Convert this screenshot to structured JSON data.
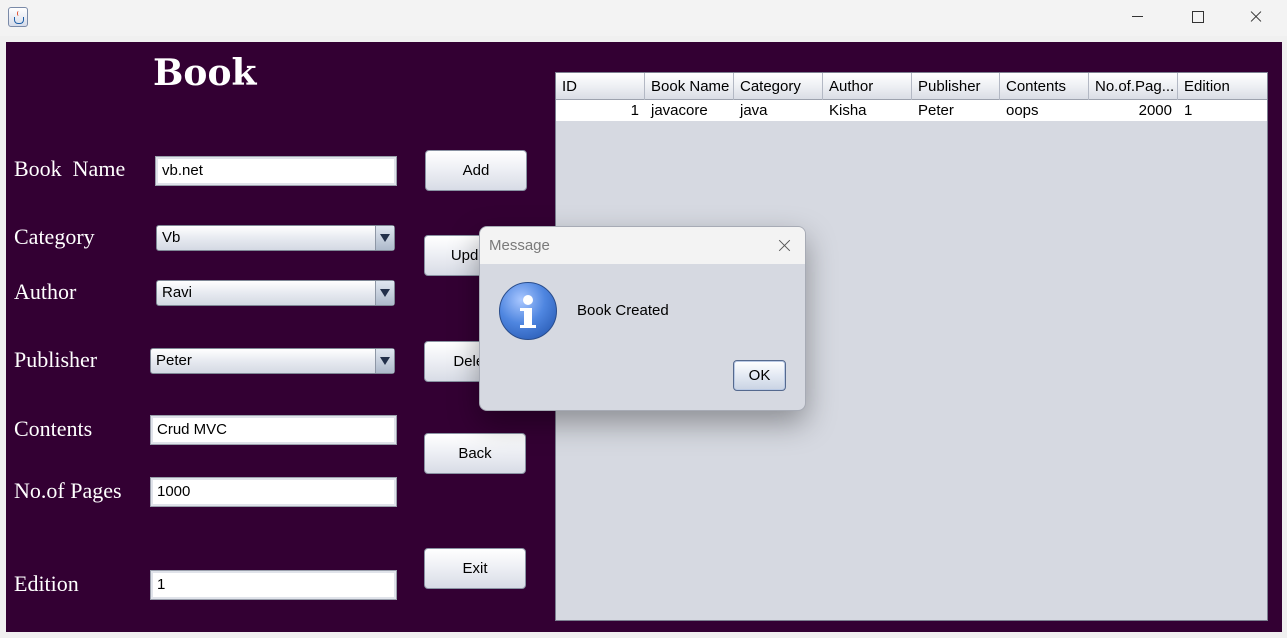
{
  "window": {
    "icon": "java-cup-icon"
  },
  "form": {
    "title": "Book",
    "labels": {
      "book_name": "Book  Name",
      "category": "Category",
      "author": "Author",
      "publisher": "Publisher",
      "contents": "Contents",
      "pages": "No.of Pages",
      "edition": "Edition"
    },
    "fields": {
      "book_name": "vb.net",
      "category": "Vb",
      "author": "Ravi",
      "publisher": "Peter",
      "contents": "Crud MVC",
      "pages": "1000",
      "edition": "1"
    },
    "buttons": {
      "add": "Add",
      "update": "Update",
      "delete": "Delete",
      "back": "Back",
      "exit": "Exit"
    }
  },
  "table": {
    "columns": [
      "ID",
      "Book Name",
      "Category",
      "Author",
      "Publisher",
      "Contents",
      "No.of.Pag...",
      "Edition"
    ],
    "rows": [
      [
        "1",
        "javacore",
        "java",
        "Kisha",
        "Peter",
        "oops",
        "2000",
        "1"
      ]
    ]
  },
  "dialog": {
    "title": "Message",
    "message": "Book Created",
    "ok_label": "OK",
    "icon": "information-icon"
  }
}
